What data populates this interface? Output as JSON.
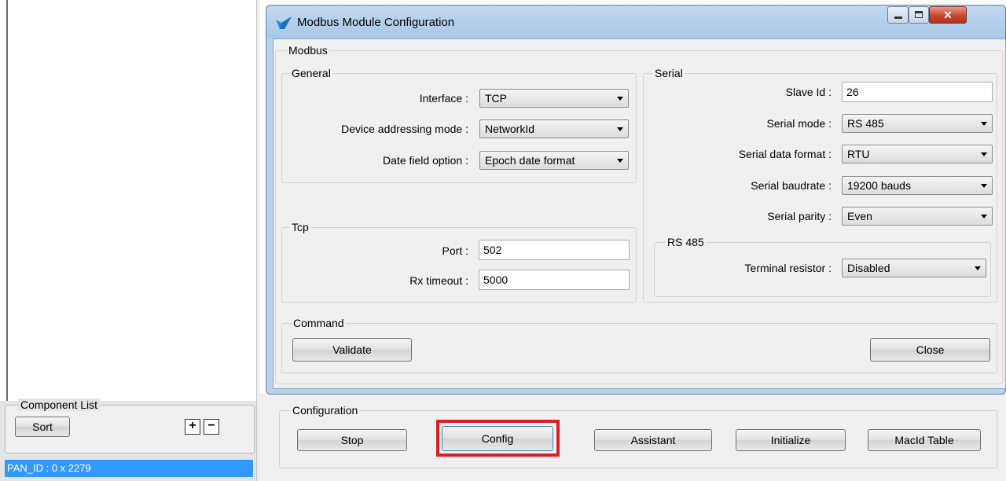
{
  "dialog": {
    "title": "Modbus Module Configuration",
    "modbus_group": "Modbus",
    "general": {
      "title": "General",
      "interface_label": "Interface :",
      "interface_value": "TCP",
      "addressing_label": "Device addressing mode :",
      "addressing_value": "NetworkId",
      "date_label": "Date field option :",
      "date_value": "Epoch date format"
    },
    "tcp": {
      "title": "Tcp",
      "port_label": "Port :",
      "port_value": "502",
      "rx_label": "Rx timeout :",
      "rx_value": "5000"
    },
    "serial": {
      "title": "Serial",
      "slave_label": "Slave Id :",
      "slave_value": "26",
      "mode_label": "Serial mode :",
      "mode_value": "RS 485",
      "format_label": "Serial data format :",
      "format_value": "RTU",
      "baud_label": "Serial baudrate :",
      "baud_value": "19200 bauds",
      "parity_label": "Serial parity :",
      "parity_value": "Even"
    },
    "rs485": {
      "title": "RS 485",
      "terminal_label": "Terminal resistor :",
      "terminal_value": "Disabled"
    },
    "command": {
      "title": "Command",
      "validate_label": "Validate",
      "close_label": "Close"
    }
  },
  "component_list": {
    "title": "Component List",
    "sort_label": "Sort",
    "plus_label": "+",
    "minus_label": "−",
    "item": "PAN_ID : 0 x 2279"
  },
  "configuration": {
    "title": "Configuration",
    "buttons": [
      "Stop",
      "Config",
      "Assistant",
      "Initialize",
      "MacId Table"
    ]
  },
  "colors": {
    "highlight": "#e21b23",
    "selection": "#3399ff"
  }
}
